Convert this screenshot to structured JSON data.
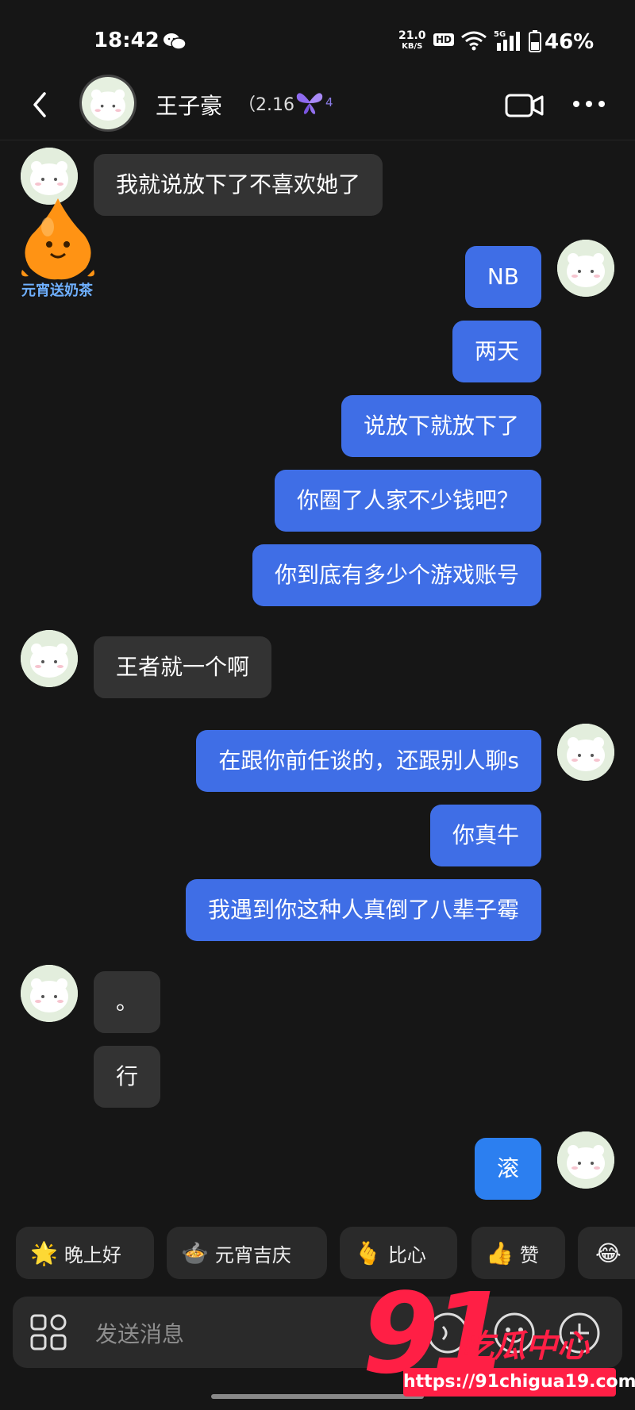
{
  "status_bar": {
    "time": "18:42",
    "net_speed": "21.0",
    "net_unit": "KB/S",
    "hd": "HD",
    "network": "5G",
    "battery": "46%"
  },
  "header": {
    "name": "王子豪",
    "paren": "（2.16",
    "level": "4"
  },
  "gift": {
    "label": "元宵送奶茶"
  },
  "messages": [
    {
      "from": "them",
      "text": "我就说放下了不喜欢她了"
    },
    {
      "from": "me",
      "text": "NB"
    },
    {
      "from": "me",
      "text": "两天"
    },
    {
      "from": "me",
      "text": "说放下就放下了"
    },
    {
      "from": "me",
      "text": "你圈了人家不少钱吧？"
    },
    {
      "from": "me",
      "text": "你到底有多少个游戏账号"
    },
    {
      "from": "them",
      "text": "王者就一个啊"
    },
    {
      "from": "me",
      "text": "在跟你前任谈的，还跟别人聊s"
    },
    {
      "from": "me",
      "text": "你真牛"
    },
    {
      "from": "me",
      "text": "我遇到你这种人真倒了八辈子霉"
    },
    {
      "from": "them",
      "text": "。"
    },
    {
      "from": "them",
      "text": "行"
    },
    {
      "from": "me",
      "text": "滚"
    }
  ],
  "quick_replies": [
    {
      "icon": "star-face-icon",
      "label": "晚上好"
    },
    {
      "icon": "rice-bowl-icon",
      "label": "元宵吉庆"
    },
    {
      "icon": "heart-hands-icon",
      "label": "比心"
    },
    {
      "icon": "thumbs-up-icon",
      "label": "赞"
    },
    {
      "icon": "laughing-face-icon",
      "label": ""
    }
  ],
  "input": {
    "placeholder": "发送消息"
  },
  "watermark": {
    "number": "91",
    "text": "吃瓜中心",
    "url": "https://91chigua19.com"
  },
  "colors": {
    "background": "#161616",
    "sent_bubble": "#3f6ee6",
    "received_bubble": "#333333",
    "watermark": "#ff1f45"
  }
}
